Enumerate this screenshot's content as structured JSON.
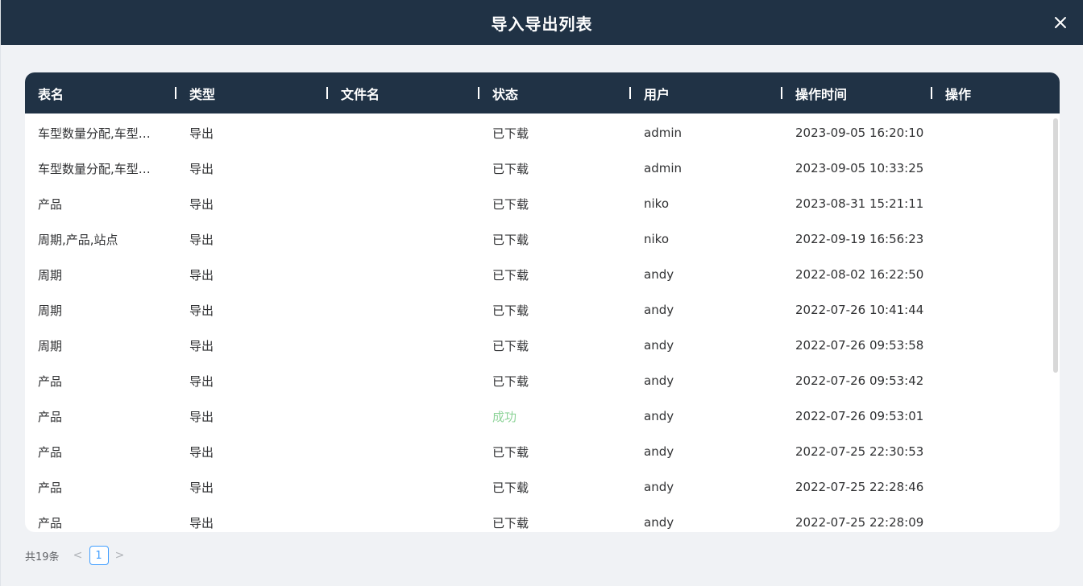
{
  "dialog": {
    "title": "导入导出列表",
    "close_icon": "close-icon"
  },
  "colors": {
    "header_bg": "#203245",
    "success_text": "#67c23a",
    "page_active": "#409eff"
  },
  "table": {
    "columns": [
      "表名",
      "类型",
      "文件名",
      "状态",
      "用户",
      "操作时间",
      "操作"
    ],
    "rows": [
      {
        "name": "车型数量分配,车型…",
        "type": "导出",
        "file": "",
        "status": "已下载",
        "user": "admin",
        "time": "2023-09-05 16:20:10",
        "op": ""
      },
      {
        "name": "车型数量分配,车型…",
        "type": "导出",
        "file": "",
        "status": "已下载",
        "user": "admin",
        "time": "2023-09-05 10:33:25",
        "op": ""
      },
      {
        "name": "产品",
        "type": "导出",
        "file": "",
        "status": "已下载",
        "user": "niko",
        "time": "2023-08-31 15:21:11",
        "op": ""
      },
      {
        "name": "周期,产品,站点",
        "type": "导出",
        "file": "",
        "status": "已下载",
        "user": "niko",
        "time": "2022-09-19 16:56:23",
        "op": ""
      },
      {
        "name": "周期",
        "type": "导出",
        "file": "",
        "status": "已下载",
        "user": "andy",
        "time": "2022-08-02 16:22:50",
        "op": ""
      },
      {
        "name": "周期",
        "type": "导出",
        "file": "",
        "status": "已下载",
        "user": "andy",
        "time": "2022-07-26 10:41:44",
        "op": ""
      },
      {
        "name": "周期",
        "type": "导出",
        "file": "",
        "status": "已下载",
        "user": "andy",
        "time": "2022-07-26 09:53:58",
        "op": ""
      },
      {
        "name": "产品",
        "type": "导出",
        "file": "",
        "status": "已下载",
        "user": "andy",
        "time": "2022-07-26 09:53:42",
        "op": ""
      },
      {
        "name": "产品",
        "type": "导出",
        "file": "",
        "status": "成功",
        "user": "andy",
        "time": "2022-07-26 09:53:01",
        "op": ""
      },
      {
        "name": "产品",
        "type": "导出",
        "file": "",
        "status": "已下载",
        "user": "andy",
        "time": "2022-07-25 22:30:53",
        "op": ""
      },
      {
        "name": "产品",
        "type": "导出",
        "file": "",
        "status": "已下载",
        "user": "andy",
        "time": "2022-07-25 22:28:46",
        "op": ""
      },
      {
        "name": "产品",
        "type": "导出",
        "file": "",
        "status": "已下载",
        "user": "andy",
        "time": "2022-07-25 22:28:09",
        "op": ""
      }
    ]
  },
  "pagination": {
    "total_label": "共19条",
    "prev_icon": "chevron-left-icon",
    "next_icon": "chevron-right-icon",
    "prev_glyph": "<",
    "next_glyph": ">",
    "current_page": "1"
  }
}
